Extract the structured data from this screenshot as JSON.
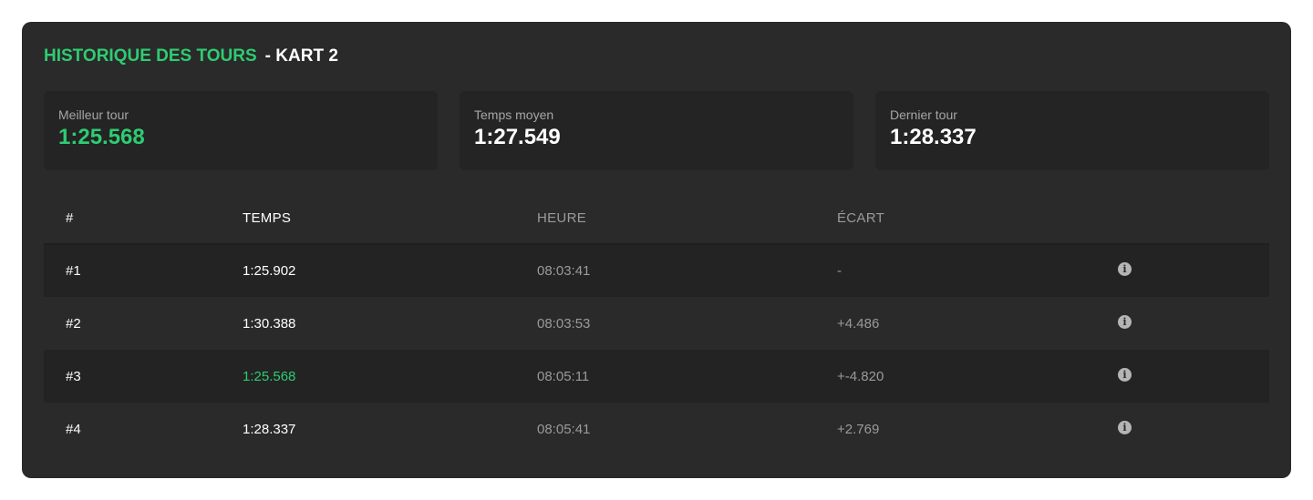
{
  "header": {
    "title": "HISTORIQUE DES TOURS",
    "subtitle": "- KART 2"
  },
  "stats": [
    {
      "label": "Meilleur tour",
      "value": "1:25.568"
    },
    {
      "label": "Temps moyen",
      "value": "1:27.549"
    },
    {
      "label": "Dernier tour",
      "value": "1:28.337"
    }
  ],
  "table": {
    "columns": [
      "#",
      "TEMPS",
      "HEURE",
      "ÉCART"
    ],
    "rows": [
      {
        "num": "#1",
        "time": "1:25.902",
        "heure": "08:03:41",
        "ecart": "-"
      },
      {
        "num": "#2",
        "time": "1:30.388",
        "heure": "08:03:53",
        "ecart": "+4.486"
      },
      {
        "num": "#3",
        "time": "1:25.568",
        "heure": "08:05:11",
        "ecart": "+-4.820"
      },
      {
        "num": "#4",
        "time": "1:28.337",
        "heure": "08:05:41",
        "ecart": "+2.769"
      }
    ]
  },
  "icons": {
    "info": "info-icon"
  },
  "colors": {
    "accent": "#2ecc71",
    "panel": "#2a2a2a",
    "card": "#242424"
  }
}
